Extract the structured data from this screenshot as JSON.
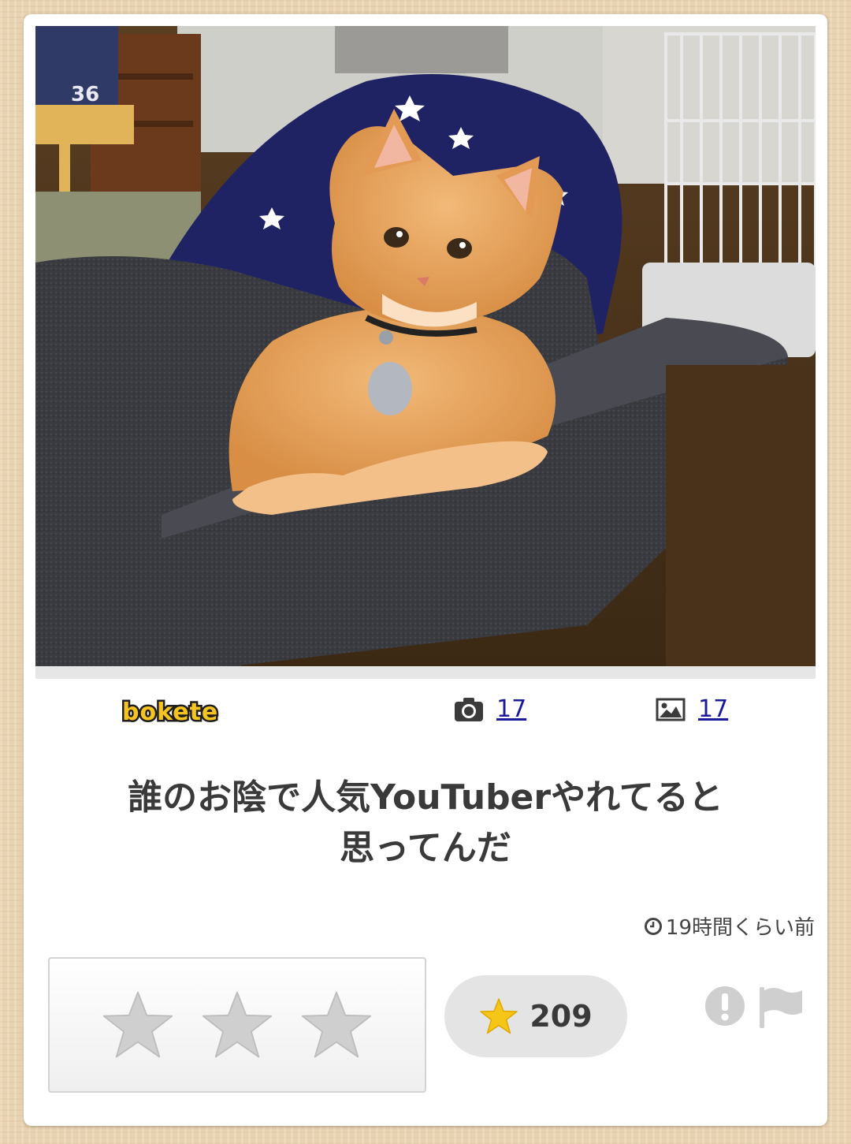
{
  "post": {
    "image_alt": "Orange tabby cat leaning over a dark sofa armrest",
    "logo_text": "bokete",
    "photo_count": "17",
    "image_count": "17",
    "caption_line1": "誰のお陰で人気YouTuberやれてると",
    "caption_line2": "思ってんだ",
    "timestamp": "19時間くらい前",
    "score": "209"
  },
  "icons": {
    "camera": "camera-icon",
    "image": "image-icon",
    "clock": "clock-icon",
    "star_rate": "star-outline-icon",
    "star_score": "star-filled-icon",
    "report": "exclamation-icon",
    "flag": "flag-icon"
  },
  "colors": {
    "accent_star": "#f5c518",
    "rating_star": "#cfcfcf",
    "link": "#1a1a9a",
    "background": "#ecd6b5"
  }
}
